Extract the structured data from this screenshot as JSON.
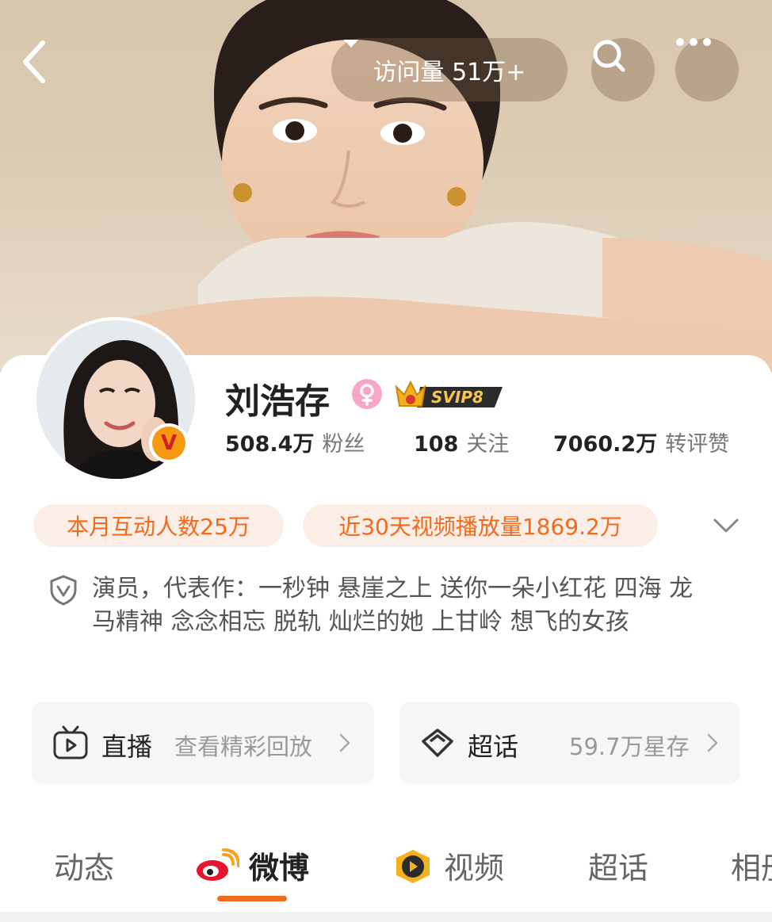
{
  "header": {
    "visit_label": "访问量 51万+"
  },
  "profile": {
    "name": "刘浩存",
    "vip_badge": "SVIP8",
    "verified_badge": "V",
    "stats": [
      {
        "num": "508.4万",
        "label": "粉丝"
      },
      {
        "num": "108",
        "label": "关注"
      },
      {
        "num": "7060.2万",
        "label": "转评赞"
      }
    ],
    "chips": [
      "本月互动人数25万",
      "近30天视频播放量1869.2万"
    ],
    "bio": "演员，代表作：一秒钟 悬崖之上 送你一朵小红花 四海 龙马精神 念念相忘 脱轨 灿烂的她 上甘岭 想飞的女孩"
  },
  "entries": {
    "live": {
      "title": "直播",
      "sub": "查看精彩回放"
    },
    "topic": {
      "title": "超话",
      "sub": "59.7万星存"
    }
  },
  "tabs": [
    {
      "label": "动态"
    },
    {
      "label": "微博"
    },
    {
      "label": "视频"
    },
    {
      "label": "超话"
    },
    {
      "label": "相册"
    }
  ],
  "colors": {
    "accent": "#f26a1b",
    "chip_bg": "#fbeee6",
    "entry_bg": "#f6f6f6"
  },
  "icons": [
    "back-arrow-icon",
    "dropdown-caret-icon",
    "search-icon",
    "more-icon",
    "female-icon",
    "verified-v-icon",
    "crown-icon",
    "chevron-down-icon",
    "shield-check-icon",
    "tv-play-icon",
    "chevron-right-icon",
    "supertopic-diamond-icon",
    "weibo-logo-icon",
    "video-play-icon"
  ]
}
